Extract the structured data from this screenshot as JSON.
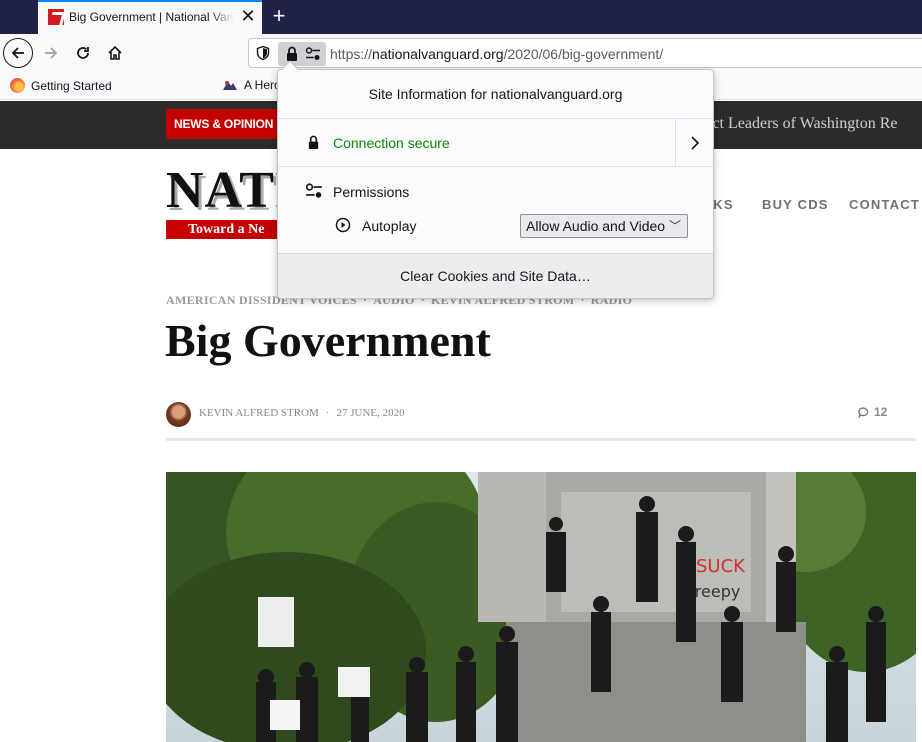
{
  "browser": {
    "tab": {
      "title": "Big Government | National Vanguard"
    },
    "url": {
      "scheme": "https://",
      "host": "nationalvanguard.org",
      "path": "/2020/06/big-government/"
    },
    "bookmarks": [
      "Getting Started",
      "A Hero"
    ]
  },
  "site_info_popup": {
    "title": "Site Information for nationalvanguard.org",
    "connection": "Connection secure",
    "permissions_label": "Permissions",
    "autoplay_label": "Autoplay",
    "autoplay_value": "Allow Audio and Video",
    "clear_button": "Clear Cookies and Site Data…"
  },
  "site": {
    "news_badge": "NEWS & OPINION",
    "ticker": "dict Leaders of Washington Re",
    "logo": "NATIO",
    "logo_sub": "Toward a Ne",
    "menu": [
      "OKS",
      "BUY CDS",
      "CONTACT"
    ],
    "categories": [
      "AMERICAN DISSIDENT VOICES",
      "AUDIO",
      "KEVIN ALFRED STROM",
      "RADIO"
    ],
    "post_title": "Big Government",
    "author": "KEVIN ALFRED STROM",
    "date": "27 JUNE, 2020",
    "comments_count": "12"
  },
  "colors": {
    "tabbar": "#1f2147",
    "brand_red": "#c40000",
    "secure_green": "#058b00",
    "dark_strip": "#2b2b2b"
  },
  "icons": {
    "tab": "site-favicon",
    "nav": [
      "back-arrow-icon",
      "forward-arrow-icon",
      "reload-icon",
      "home-icon"
    ],
    "url": [
      "tracking-shield-icon",
      "lock-icon",
      "permissions-icon"
    ],
    "popup": [
      "lock-icon",
      "chevron-right-icon",
      "permissions-icon",
      "autoplay-icon"
    ]
  }
}
